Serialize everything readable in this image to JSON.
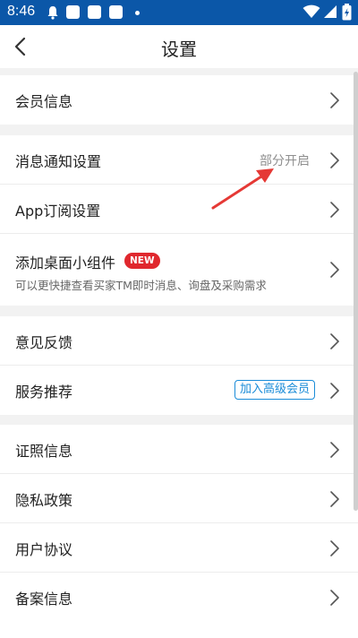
{
  "status_bar": {
    "time": "8:46",
    "icons": [
      "notification-bell",
      "app-notification",
      "app-notification",
      "app-notification",
      "dot",
      "wifi",
      "signal",
      "battery"
    ]
  },
  "header": {
    "title": "设置",
    "back_icon": "chevron-left"
  },
  "groups": [
    {
      "items": [
        {
          "label": "会员信息"
        }
      ]
    },
    {
      "items": [
        {
          "label": "消息通知设置",
          "value": "部分开启"
        },
        {
          "label": "App订阅设置"
        },
        {
          "label": "添加桌面小组件",
          "badge": "NEW",
          "subtitle": "可以更快捷查看买家TM即时消息、询盘及采购需求"
        }
      ]
    },
    {
      "items": [
        {
          "label": "意见反馈"
        },
        {
          "label": "服务推荐",
          "badge": "加入高级会员"
        }
      ]
    },
    {
      "items": [
        {
          "label": "证照信息"
        },
        {
          "label": "隐私政策"
        },
        {
          "label": "用户协议"
        },
        {
          "label": "备案信息"
        }
      ]
    }
  ],
  "colors": {
    "status_bar": "#0b57a8",
    "new_badge": "#e0282e",
    "vip_badge": "#1a8cd8",
    "annotation_arrow": "#e53935"
  }
}
